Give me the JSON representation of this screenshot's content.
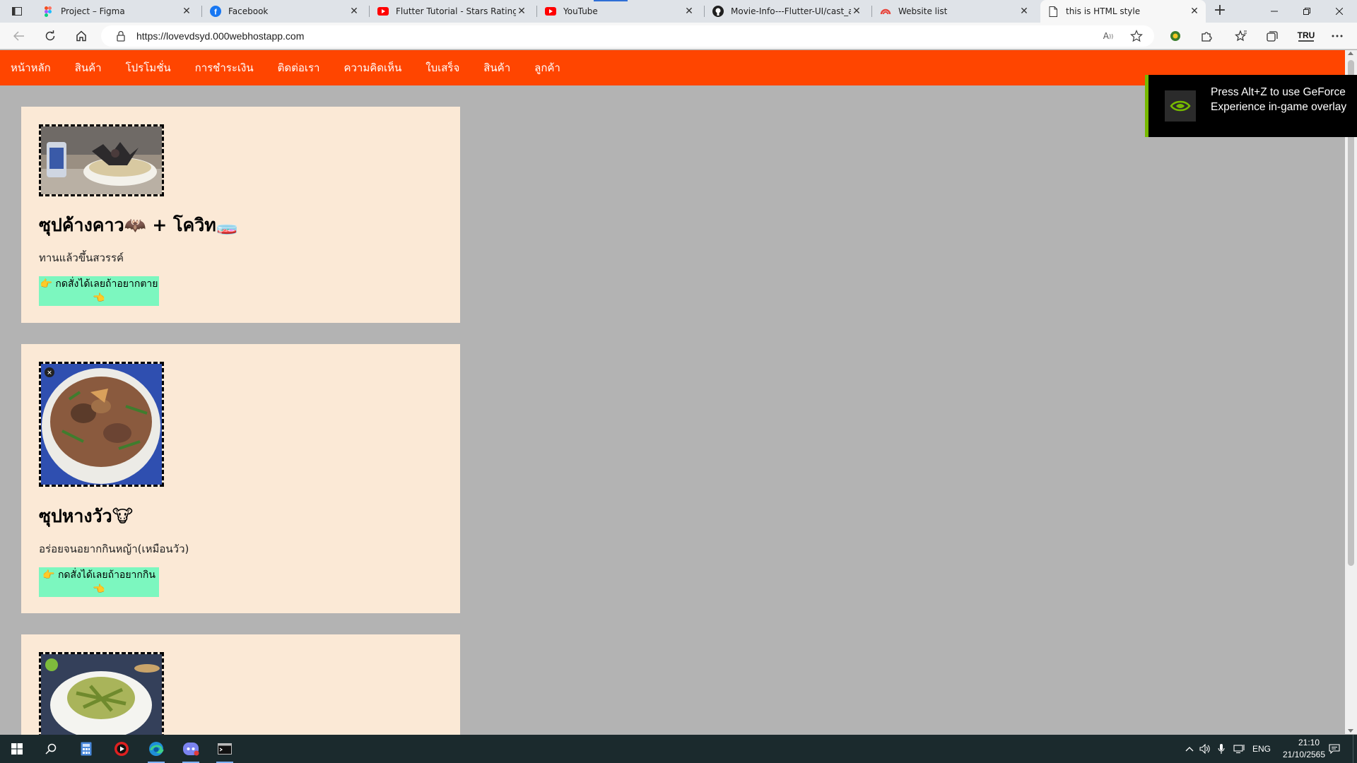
{
  "browser": {
    "tabs": [
      {
        "title": "Project – Figma",
        "icon": "figma-icon"
      },
      {
        "title": "Facebook",
        "icon": "facebook-icon"
      },
      {
        "title": "Flutter Tutorial - Stars Rating Ba",
        "icon": "youtube-icon"
      },
      {
        "title": "YouTube",
        "icon": "youtube-icon"
      },
      {
        "title": "Movie-Info---Flutter-UI/cast_an",
        "icon": "github-icon"
      },
      {
        "title": "Website list",
        "icon": "000webhost-icon"
      },
      {
        "title": "this is HTML style",
        "icon": "page-icon",
        "active": true
      }
    ],
    "url": "https://lovevdsyd.000webhostapp.com"
  },
  "nav": {
    "items": [
      "หน้าหลัก",
      "สินค้า",
      "โปรโมชั่น",
      "การชำระเงิน",
      "ติดต่อเรา",
      "ความคิดเห็น",
      "ใบเสร็จ",
      "สินค้า",
      "ลูกค้า"
    ]
  },
  "cards": [
    {
      "title": "ซุปค้างคาว🦇 + โควิท🧫",
      "desc": "ทานแล้วขึ้นสวรรค์",
      "button": "👉 กดสั่งได้เลยถ้าอยากตาย 👈"
    },
    {
      "title": "ซุปหางวัว🐮",
      "desc": "อร่อยจนอยากกินหญ้า(เหมือนวัว)",
      "button": "👉 กดสั่งได้เลยถ้าอยากกิน 👈"
    },
    {
      "title": "",
      "desc": "",
      "button": ""
    }
  ],
  "overlay": {
    "text": "Press Alt+Z to use GeForce Experience in-game overlay"
  },
  "taskbar": {
    "language": "ENG",
    "time": "21:10",
    "date": "21/10/2565"
  },
  "colors": {
    "nav_bg": "#ff4500",
    "card_bg": "#fbe9d6",
    "page_bg": "#b3b3b3",
    "button_bg": "#7cf7bf"
  }
}
